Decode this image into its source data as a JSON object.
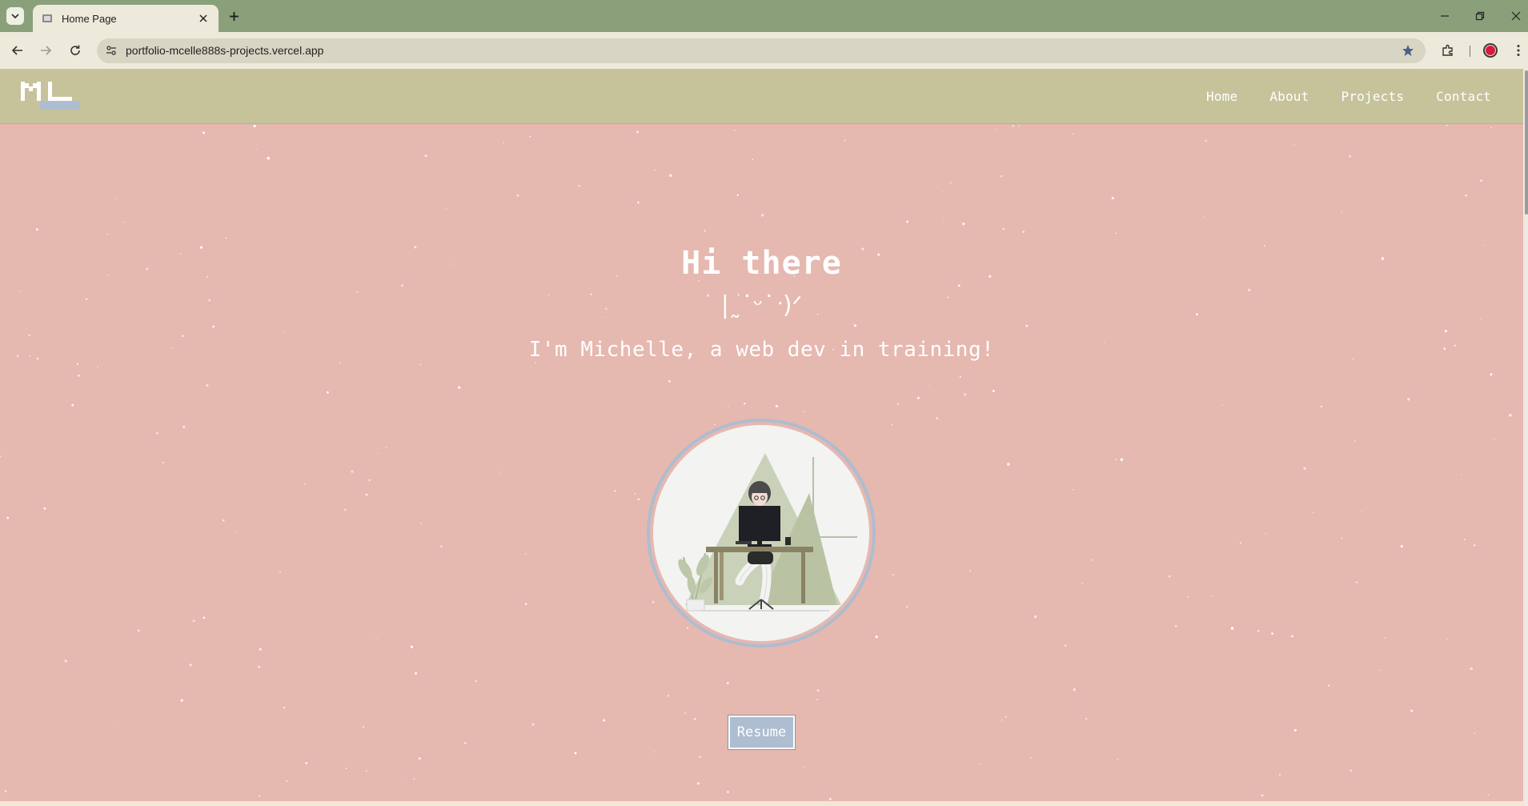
{
  "browser": {
    "tab_title": "Home Page",
    "url": "portfolio-mcelle888s-projects.vercel.app"
  },
  "site": {
    "logo_text": "ML",
    "nav": [
      {
        "label": "Home"
      },
      {
        "label": "About"
      },
      {
        "label": "Projects"
      },
      {
        "label": "Contact"
      }
    ]
  },
  "hero": {
    "title": "Hi there",
    "kaomoji": "|˷˙ᵕ˙ )ᐟ",
    "subtitle": "I'm Michelle, a web dev in training!",
    "resume_label": "Resume"
  },
  "colors": {
    "tabbar": "#8aa07a",
    "toolbar": "#eeeadb",
    "site_header": "#c6c39b",
    "page_background": "#e5b8b0",
    "resume_button": "#aebdd0",
    "accent_green": "#b9c3a4"
  }
}
